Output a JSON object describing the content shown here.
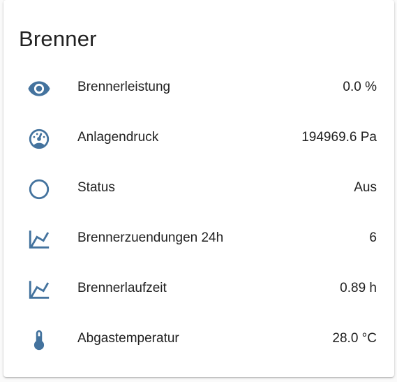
{
  "card": {
    "title": "Brenner"
  },
  "colors": {
    "icon": "#44739e",
    "text": "#212121",
    "background": "#ffffff"
  },
  "entities": [
    {
      "icon": "eye-icon",
      "label": "Brennerleistung",
      "value": "0.0 %"
    },
    {
      "icon": "gauge-icon",
      "label": "Anlagendruck",
      "value": "194969.6 Pa"
    },
    {
      "icon": "circle-outline-icon",
      "label": "Status",
      "value": "Aus"
    },
    {
      "icon": "chart-line-icon",
      "label": "Brennerzuendungen 24h",
      "value": "6"
    },
    {
      "icon": "chart-line-icon",
      "label": "Brennerlaufzeit",
      "value": "0.89 h"
    },
    {
      "icon": "thermometer-icon",
      "label": "Abgastemperatur",
      "value": "28.0 °C"
    }
  ]
}
